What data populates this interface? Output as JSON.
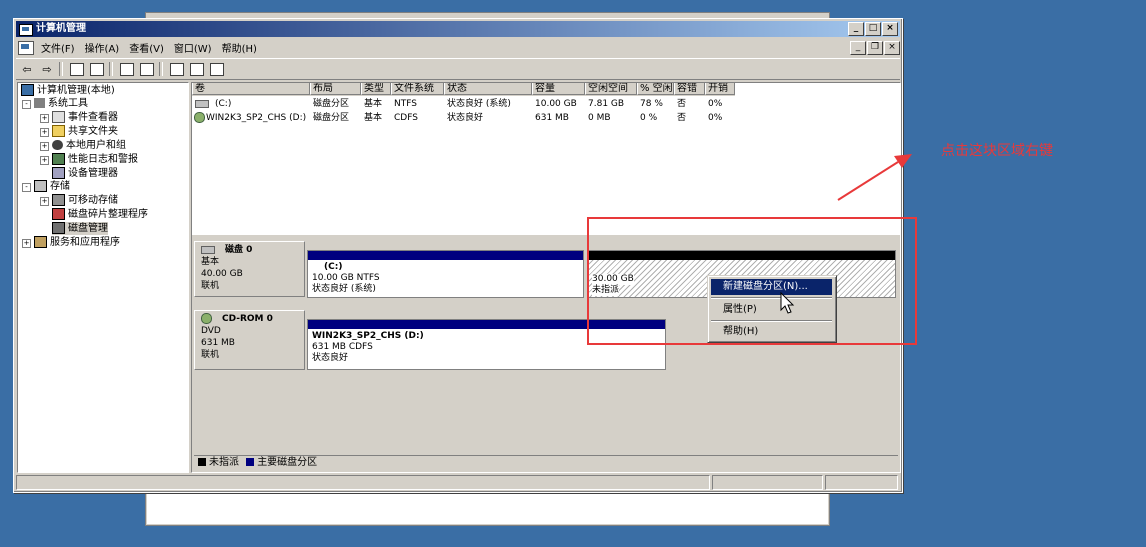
{
  "window": {
    "title": "计算机管理"
  },
  "menu": [
    "文件(F)",
    "操作(A)",
    "查看(V)",
    "窗口(W)",
    "帮助(H)"
  ],
  "tree": {
    "root": "计算机管理(本地)",
    "system_tools": "系统工具",
    "event_viewer": "事件查看器",
    "shared_folders": "共享文件夹",
    "local_users": "本地用户和组",
    "perf_logs": "性能日志和警报",
    "device_manager": "设备管理器",
    "storage": "存储",
    "removable": "可移动存储",
    "defrag": "磁盘碎片整理程序",
    "disk_mgmt": "磁盘管理",
    "services": "服务和应用程序"
  },
  "volume_table": {
    "headers": [
      "卷",
      "布局",
      "类型",
      "文件系统",
      "状态",
      "容量",
      "空闲空间",
      "% 空闲",
      "容错",
      "开销"
    ],
    "rows": [
      [
        "(C:)",
        "磁盘分区",
        "基本",
        "NTFS",
        "状态良好 (系统)",
        "10.00 GB",
        "7.81 GB",
        "78 %",
        "否",
        "0%"
      ],
      [
        "WIN2K3_SP2_CHS (D:)",
        "磁盘分区",
        "基本",
        "CDFS",
        "状态良好",
        "631 MB",
        "0 MB",
        "0 %",
        "否",
        "0%"
      ]
    ]
  },
  "disk0": {
    "name": "磁盘 0",
    "type": "基本",
    "size": "40.00 GB",
    "status": "联机",
    "partition": {
      "label": "(C:)",
      "info": "10.00 GB NTFS",
      "status": "状态良好 (系统)"
    },
    "unallocated": {
      "size": "30.00 GB",
      "label": "未指派"
    }
  },
  "cdrom0": {
    "name": "CD-ROM 0",
    "type": "DVD",
    "size": "631 MB",
    "status": "联机",
    "partition": {
      "label": "WIN2K3_SP2_CHS  (D:)",
      "info": "631 MB CDFS",
      "status": "状态良好"
    }
  },
  "legend": {
    "unallocated": "未指派",
    "primary": "主要磁盘分区"
  },
  "context_menu": {
    "new_partition": "新建磁盘分区(N)...",
    "properties": "属性(P)",
    "help": "帮助(H)"
  },
  "annotation": "点击这块区域右键",
  "colors": {
    "primary": "#00007f",
    "unallocated": "#000000",
    "annotation": "#e8393a",
    "desktop": "#3a6ea5"
  }
}
